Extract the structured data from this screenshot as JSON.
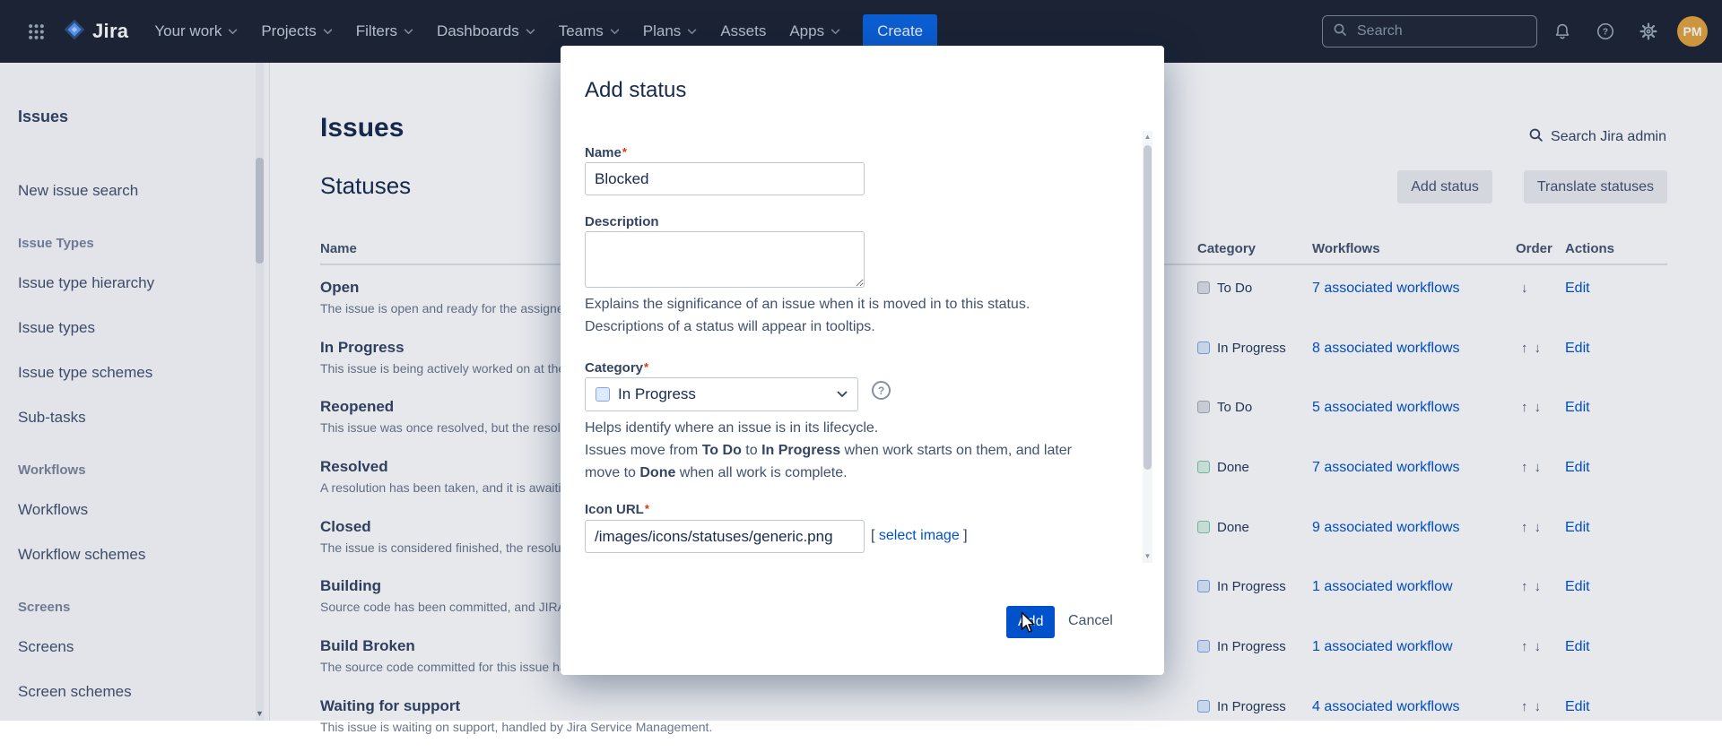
{
  "colors": {
    "navbar_bg": "#1E2433",
    "accent_blue": "#0052CC",
    "create_button_blue": "#0C66E4",
    "required_marker_red": "#DE350B",
    "avatar_bg": "#E2A33E",
    "category_todo": "#DFE1E6",
    "category_inprogress": "#DEEBFF",
    "category_done": "#DFF3E8"
  },
  "icons": {
    "question_mark": "?",
    "move_up": "↑",
    "move_down": "↓",
    "scroll_up": "▲",
    "scroll_down": "▼"
  },
  "navbar": {
    "logo_text": "Jira",
    "items": [
      {
        "label": "Your work"
      },
      {
        "label": "Projects"
      },
      {
        "label": "Filters"
      },
      {
        "label": "Dashboards"
      },
      {
        "label": "Teams"
      },
      {
        "label": "Plans"
      },
      {
        "label": "Assets"
      },
      {
        "label": "Apps"
      }
    ],
    "create_label": "Create",
    "search_placeholder": "Search",
    "avatar_initials": "PM"
  },
  "sidebar": {
    "title": "Issues",
    "new_issue_search": "New issue search",
    "sections": [
      {
        "header": "Issue Types",
        "items": [
          "Issue type hierarchy",
          "Issue types",
          "Issue type schemes",
          "Sub-tasks"
        ]
      },
      {
        "header": "Workflows",
        "items": [
          "Workflows",
          "Workflow schemes"
        ]
      },
      {
        "header": "Screens",
        "items": [
          "Screens",
          "Screen schemes"
        ]
      }
    ]
  },
  "main": {
    "page_title": "Issues",
    "section_title": "Statuses",
    "admin_search_label": "Search Jira admin",
    "add_status_button": "Add status",
    "translate_button": "Translate statuses",
    "table": {
      "headers": [
        "Name",
        "Category",
        "Workflows",
        "Order",
        "Actions"
      ],
      "rows": [
        {
          "name": "Open",
          "description": "The issue is open and ready for the assignee to start work on it.",
          "category": "To Do",
          "workflows": "7 associated workflows",
          "action": "Edit"
        },
        {
          "name": "In Progress",
          "description": "This issue is being actively worked on at the moment by the assignee.",
          "category": "In Progress",
          "workflows": "8 associated workflows",
          "action": "Edit"
        },
        {
          "name": "Reopened",
          "description": "This issue was once resolved, but the resolution was deemed incorrect.",
          "category": "To Do",
          "workflows": "5 associated workflows",
          "action": "Edit"
        },
        {
          "name": "Resolved",
          "description": "A resolution has been taken, and it is awaiting verification by reporter.",
          "category": "Done",
          "workflows": "7 associated workflows",
          "action": "Edit"
        },
        {
          "name": "Closed",
          "description": "The issue is considered finished, the resolution is correct.",
          "category": "Done",
          "workflows": "9 associated workflows",
          "action": "Edit"
        },
        {
          "name": "Building",
          "description": "Source code has been committed, and JIRA is waiting for the build to complete.",
          "category": "In Progress",
          "workflows": "1 associated workflow",
          "action": "Edit"
        },
        {
          "name": "Build Broken",
          "description": "The source code committed for this issue has broken the build.",
          "category": "In Progress",
          "workflows": "1 associated workflow",
          "action": "Edit"
        },
        {
          "name": "Waiting for support",
          "description": "This issue is waiting on support, handled by Jira Service Management.",
          "category": "In Progress",
          "workflows": "4 associated workflows",
          "action": "Edit"
        }
      ]
    }
  },
  "modal": {
    "title": "Add status",
    "required_marker": "*",
    "name_label": "Name",
    "name_value": "Blocked",
    "description_label": "Description",
    "description_help": "Explains the significance of an issue when it is moved in to this status. Descriptions of a status will appear in tooltips.",
    "category_label": "Category",
    "category_value": "In Progress",
    "category_help_line1": "Helps identify where an issue is in its lifecycle.",
    "category_help_parts": {
      "p1": "Issues move from ",
      "b1": "To Do",
      "p2": " to ",
      "b2": "In Progress",
      "p3": " when work starts on them, and later move to ",
      "b3": "Done",
      "p4": " when all work is complete."
    },
    "icon_url_label": "Icon URL",
    "icon_url_value": "/images/icons/statuses/generic.png",
    "select_image_open": "[ ",
    "select_image_label": "select image",
    "select_image_close": " ]",
    "add_button": "Add",
    "cancel_button": "Cancel"
  }
}
